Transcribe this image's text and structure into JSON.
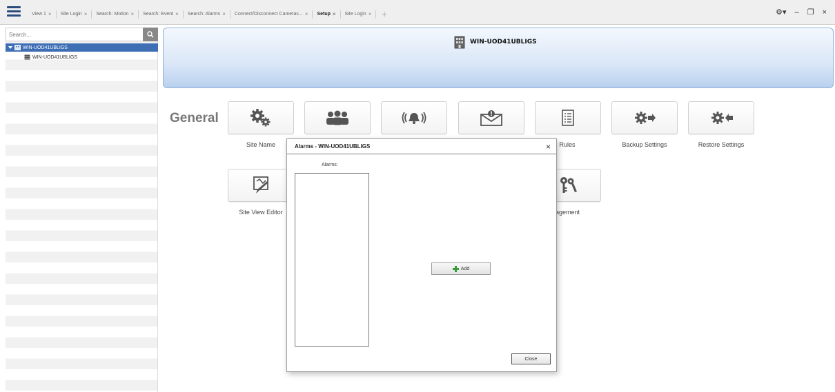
{
  "tabbar": {
    "tabs": [
      {
        "label": "View 1",
        "active": false
      },
      {
        "label": "Site Login",
        "active": false
      },
      {
        "label": "Search: Motion",
        "active": false
      },
      {
        "label": "Search: Event",
        "active": false
      },
      {
        "label": "Search: Alarms",
        "active": false
      },
      {
        "label": "Connect/Disconnect Cameras...",
        "active": false
      },
      {
        "label": "Setup",
        "active": true
      },
      {
        "label": "Site Login",
        "active": false
      }
    ],
    "close_glyph": "×",
    "add_glyph": "+",
    "window_controls": {
      "settings": "⚙▾",
      "minimize": "–",
      "restore": "❐",
      "close": "×"
    }
  },
  "sidebar": {
    "search_placeholder": "Search...",
    "tree": {
      "root": "WIN-UOD41UBLIGS",
      "child": "WIN-UOD41UBLIGS"
    }
  },
  "header": {
    "title": "WIN-UOD41UBLIGS"
  },
  "general": {
    "section_label": "General",
    "row1_labels": {
      "site_name": "Site Name",
      "rules": "Rules",
      "backup": "Backup Settings",
      "restore": "Restore Settings"
    },
    "row2_labels": {
      "site_view_editor": "Site View Editor",
      "management": "e Management"
    }
  },
  "dialog": {
    "title": "Alarms - WIN-UOD41UBLIGS",
    "close_glyph": "×",
    "alarms_label": "Alarms:",
    "add_label": "Add",
    "close_label": "Close"
  },
  "colors": {
    "accent": "#3e6fb5",
    "header_gradient_bottom": "#b9d0ee",
    "icon_gray": "#555555",
    "add_green": "#3a9b3a"
  }
}
